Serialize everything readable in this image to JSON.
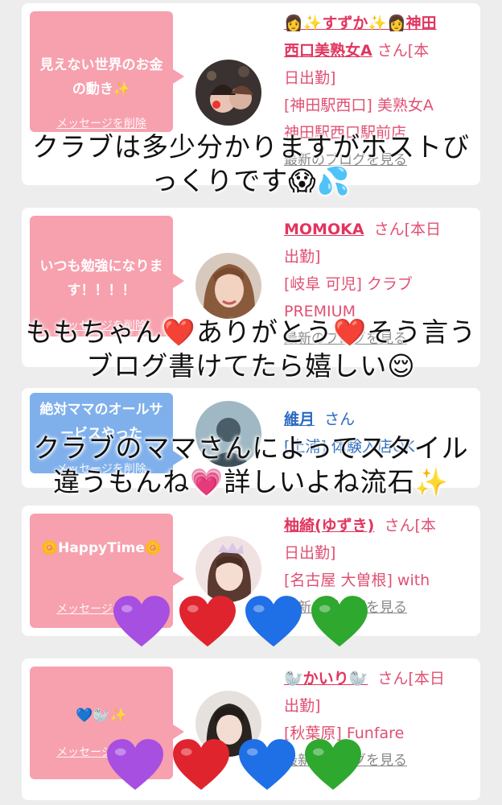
{
  "cards": [
    {
      "bubble": "見えない世界のお金の動き✨",
      "bubble_color": "#f7a0ae",
      "message_link": "メッセージを削除",
      "name_line1": "👩✨すずか✨👩神田",
      "name_line2": "西口美熟女A",
      "san": "さん[本",
      "status": "日出勤]",
      "area": "[神田駅西口] 美熟女A",
      "shop": "神田駅西口駅前店",
      "blog_link": "最新のブログを見る"
    },
    {
      "bubble": "いつも勉強になります！！！！",
      "bubble_color": "#f7a0ae",
      "message_link": "メッセージを削除",
      "name_line1": "MOMOKA",
      "san": "さん[本日",
      "status": "出勤]",
      "area": "[岐阜 可児] クラブ",
      "shop": "PREMIUM",
      "blog_link": "最新のブログを見る"
    },
    {
      "bubble": "絶対ママのオールサービスやった",
      "bubble_color": "#7fb0ec",
      "message_link": "メッセージを削除",
      "name_line1": "維月",
      "san": "さん",
      "area": "[土浦] 体験入店OK",
      "blog_link": ""
    },
    {
      "bubble": "🌼HappyTime🌼",
      "bubble_color": "#f7a0ae",
      "message_link": "メッセージを削除",
      "name_line1": "柚綺(ゆずき)",
      "san": "さん[本",
      "status": "日出勤]",
      "area": "[名古屋 大曽根] with",
      "blog_link": "最新のブログを見る"
    },
    {
      "bubble": "💙🦭✨",
      "bubble_color": "#f7a0ae",
      "message_link": "メッセージを削除",
      "name_line1": "🦭かいり🦭",
      "san": "さん[本日",
      "status": "出勤]",
      "area": "[秋葉原] Funfare",
      "blog_link": "最新のブログを見る"
    }
  ],
  "overlays": {
    "line1a": "クラブは多少分かりますがホストび",
    "line1b": "っくりです😱💦",
    "line2a": "ももちゃん❤️ありがとう❤️そう言う",
    "line2b": "ブログ書けてたら嬉しい😌",
    "line3a": "クラブのママさんによってスタイル",
    "line3b": "違うもんね💗詳しいよね流石✨"
  },
  "heart_colors": [
    "#a64fe0",
    "#e0242e",
    "#1f6fe6",
    "#2ea82e"
  ],
  "accent_colors": {
    "name": "#e0355f",
    "blue_name": "#2a6ac0",
    "link_gray": "#888888"
  }
}
